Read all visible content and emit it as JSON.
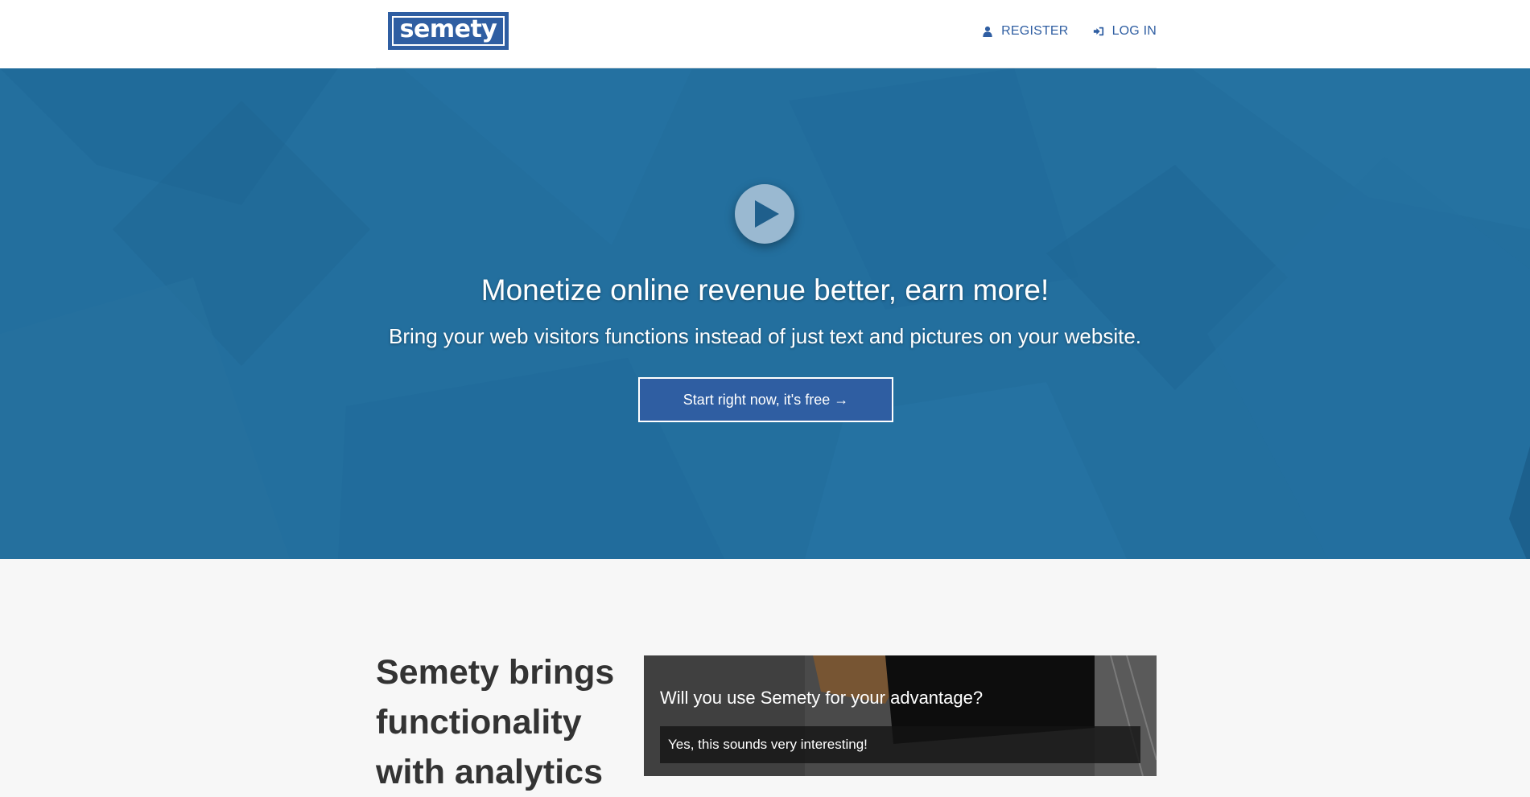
{
  "header": {
    "logo_text": "semety",
    "nav": [
      {
        "label": "REGISTER",
        "icon": "user-icon"
      },
      {
        "label": "LOG IN",
        "icon": "sign-in-icon"
      }
    ]
  },
  "hero": {
    "title": "Monetize online revenue better, earn more!",
    "subtitle": "Bring your web visitors functions instead of just text and pictures on your website.",
    "cta_label": "Start right now, it's free →",
    "background_color": "#236f9e"
  },
  "section": {
    "lead": "Semety brings functionality with analytics",
    "poll": {
      "question": "Will you use Semety for your advantage?",
      "option": "Yes, this sounds very interesting!"
    }
  },
  "colors": {
    "brand": "#2f5ea2",
    "hero": "#236f9e",
    "page_bg": "#f7f7f7",
    "text_dark": "#333333"
  }
}
